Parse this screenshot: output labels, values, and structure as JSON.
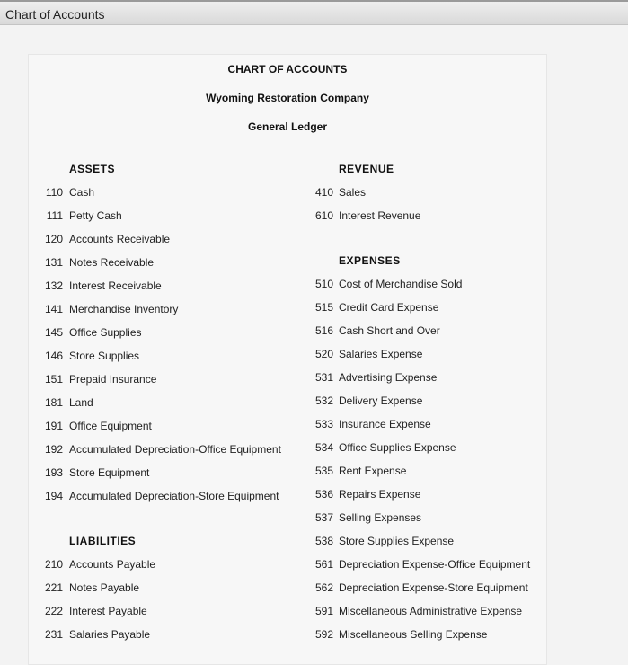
{
  "window": {
    "title": "Chart of Accounts"
  },
  "header": {
    "title": "CHART OF ACCOUNTS",
    "company": "Wyoming Restoration Company",
    "ledger": "General Ledger"
  },
  "left": {
    "assets_heading": "ASSETS",
    "assets": [
      {
        "num": "110",
        "name": "Cash"
      },
      {
        "num": "111",
        "name": "Petty Cash"
      },
      {
        "num": "120",
        "name": "Accounts Receivable"
      },
      {
        "num": "131",
        "name": "Notes Receivable"
      },
      {
        "num": "132",
        "name": "Interest Receivable"
      },
      {
        "num": "141",
        "name": "Merchandise Inventory"
      },
      {
        "num": "145",
        "name": "Office Supplies"
      },
      {
        "num": "146",
        "name": "Store Supplies"
      },
      {
        "num": "151",
        "name": "Prepaid Insurance"
      },
      {
        "num": "181",
        "name": "Land"
      },
      {
        "num": "191",
        "name": "Office Equipment"
      },
      {
        "num": "192",
        "name": "Accumulated Depreciation-Office Equipment"
      },
      {
        "num": "193",
        "name": "Store Equipment"
      },
      {
        "num": "194",
        "name": "Accumulated Depreciation-Store Equipment"
      }
    ],
    "liabilities_heading": "LIABILITIES",
    "liabilities": [
      {
        "num": "210",
        "name": "Accounts Payable"
      },
      {
        "num": "221",
        "name": "Notes Payable"
      },
      {
        "num": "222",
        "name": "Interest Payable"
      },
      {
        "num": "231",
        "name": "Salaries Payable"
      }
    ]
  },
  "right": {
    "revenue_heading": "REVENUE",
    "revenue": [
      {
        "num": "410",
        "name": "Sales"
      },
      {
        "num": "610",
        "name": "Interest Revenue"
      }
    ],
    "expenses_heading": "EXPENSES",
    "expenses": [
      {
        "num": "510",
        "name": "Cost of Merchandise Sold"
      },
      {
        "num": "515",
        "name": "Credit Card Expense"
      },
      {
        "num": "516",
        "name": "Cash Short and Over"
      },
      {
        "num": "520",
        "name": "Salaries Expense"
      },
      {
        "num": "531",
        "name": "Advertising Expense"
      },
      {
        "num": "532",
        "name": "Delivery Expense"
      },
      {
        "num": "533",
        "name": "Insurance Expense"
      },
      {
        "num": "534",
        "name": "Office Supplies Expense"
      },
      {
        "num": "535",
        "name": "Rent Expense"
      },
      {
        "num": "536",
        "name": "Repairs Expense"
      },
      {
        "num": "537",
        "name": "Selling Expenses"
      },
      {
        "num": "538",
        "name": "Store Supplies Expense"
      },
      {
        "num": "561",
        "name": "Depreciation Expense-Office Equipment"
      },
      {
        "num": "562",
        "name": "Depreciation Expense-Store Equipment"
      },
      {
        "num": "591",
        "name": "Miscellaneous Administrative Expense"
      },
      {
        "num": "592",
        "name": "Miscellaneous Selling Expense"
      }
    ]
  }
}
